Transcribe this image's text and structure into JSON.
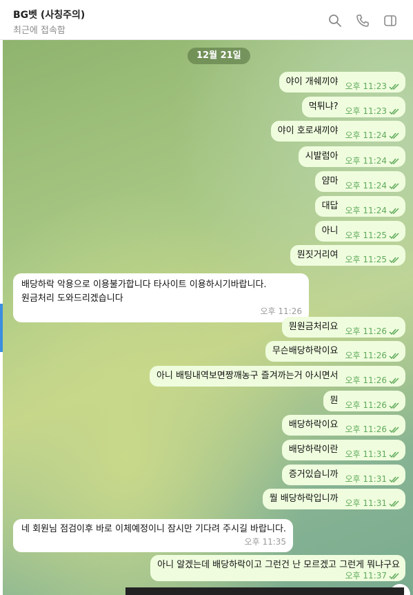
{
  "header": {
    "title": "BG벳 (사칭주의)",
    "subtitle": "최근에 접속함"
  },
  "date_divider": "12월 21일",
  "messages": {
    "m1": {
      "text": "야이 개쉐끼야",
      "time": "오후 11:23"
    },
    "m2": {
      "text": "먹튀냐?",
      "time": "오후 11:23"
    },
    "m3": {
      "text": "야이 호로새끼야",
      "time": "오후 11:24"
    },
    "m4": {
      "text": "시발럼아",
      "time": "오후 11:24"
    },
    "m5": {
      "text": "얌마",
      "time": "오후 11:24"
    },
    "m6": {
      "text": "대답",
      "time": "오후 11:24"
    },
    "m7": {
      "text": "아니",
      "time": "오후 11:25"
    },
    "m8": {
      "text": "뭔짓거리여",
      "time": "오후 11:25"
    },
    "r1": {
      "line1": "배당하락 악용으로 이용불가합니다 타사이트 이용하시기바랍니다.",
      "line2": "원금처리 도와드리겠습니다",
      "time": "오후 11:26"
    },
    "m9": {
      "text": "뭔원금처리요",
      "time": "오후 11:26"
    },
    "m10": {
      "text": "무슨배당하락이요",
      "time": "오후 11:26"
    },
    "m11": {
      "text": "아니 배팅내역보면짱깨농구 즐겨까는거 아시면서",
      "time": "오후 11:26"
    },
    "m12": {
      "text": "뭔",
      "time": "오후 11:26"
    },
    "m13": {
      "text": "배당하락이요",
      "time": "오후 11:26"
    },
    "m14": {
      "text": "배당하락이란",
      "time": "오후 11:31"
    },
    "m15": {
      "text": "증거있습니까",
      "time": "오후 11:31"
    },
    "m16": {
      "text": "뭘 배당하락입니까",
      "time": "오후 11:31"
    },
    "r2": {
      "text": "네 회원님 점검이후 바로 이체예정이니 잠시만 기다려 주시길 바랍니다.",
      "time": "오후 11:35"
    },
    "m17": {
      "text": "아니 알겠는데 배당하락이고 그런건 난 모르겠고 그런게 뭐냐구요",
      "time": "오후 11:37"
    }
  },
  "colors": {
    "outgoing": "#effdde",
    "incoming": "#ffffff",
    "check": "#5fa95a"
  }
}
